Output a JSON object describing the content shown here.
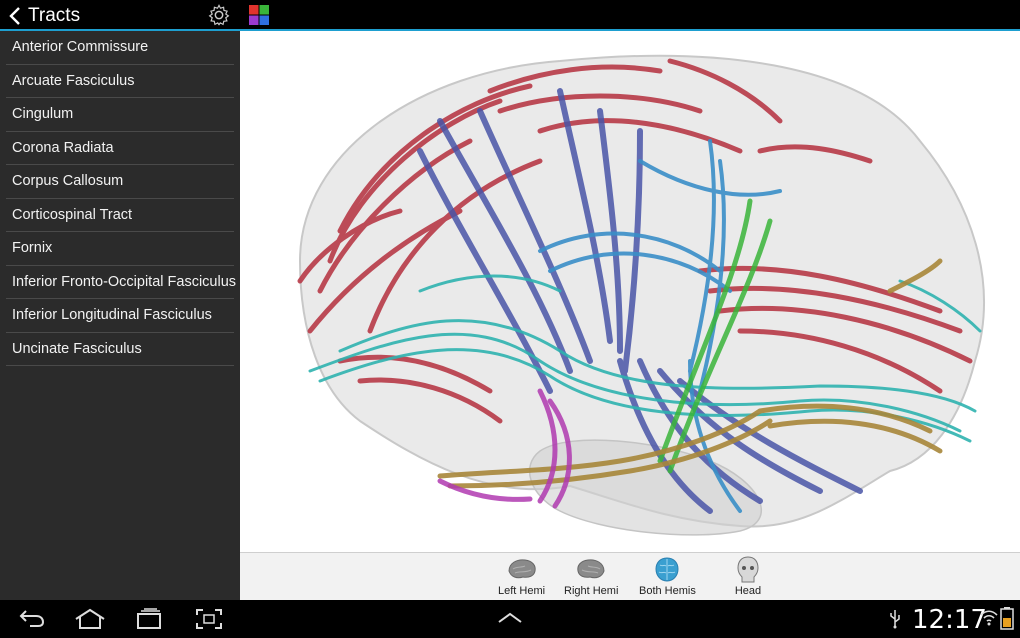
{
  "app": {
    "title": "Tracts",
    "icons": {
      "back": "chevron-left-icon",
      "settings": "gear-icon",
      "color": "color-palette-icon"
    }
  },
  "sidebar": {
    "items": [
      {
        "label": "Anterior Commissure"
      },
      {
        "label": "Arcuate Fasciculus"
      },
      {
        "label": "Cingulum"
      },
      {
        "label": "Corona Radiata"
      },
      {
        "label": "Corpus Callosum"
      },
      {
        "label": "Corticospinal Tract"
      },
      {
        "label": "Fornix"
      },
      {
        "label": "Inferior Fronto-Occipital Fasciculus"
      },
      {
        "label": "Inferior Longitudinal Fasciculus"
      },
      {
        "label": "Uncinate Fasciculus"
      }
    ]
  },
  "viewer": {
    "content": "3D brain tractography render",
    "colors": {
      "red": "#b83a48",
      "blue": "#4a55a8",
      "cyan": "#2fb3b0",
      "lightblue": "#3a8fc8",
      "green": "#3ab53a",
      "gold": "#a8873a",
      "magenta": "#b03ab0"
    }
  },
  "view_toolbar": {
    "buttons": [
      {
        "label": "Left Hemi",
        "icon": "left-hemisphere-icon"
      },
      {
        "label": "Right Hemi",
        "icon": "right-hemisphere-icon"
      },
      {
        "label": "Both Hemis",
        "icon": "both-hemispheres-icon",
        "active": true
      },
      {
        "label": "Head",
        "icon": "head-icon"
      }
    ]
  },
  "system_bar": {
    "time": "12:17",
    "icons": [
      "back-icon",
      "home-icon",
      "recent-apps-icon",
      "screenshot-icon",
      "up-chevron-icon",
      "usb-icon",
      "wifi-icon",
      "battery-icon"
    ]
  }
}
